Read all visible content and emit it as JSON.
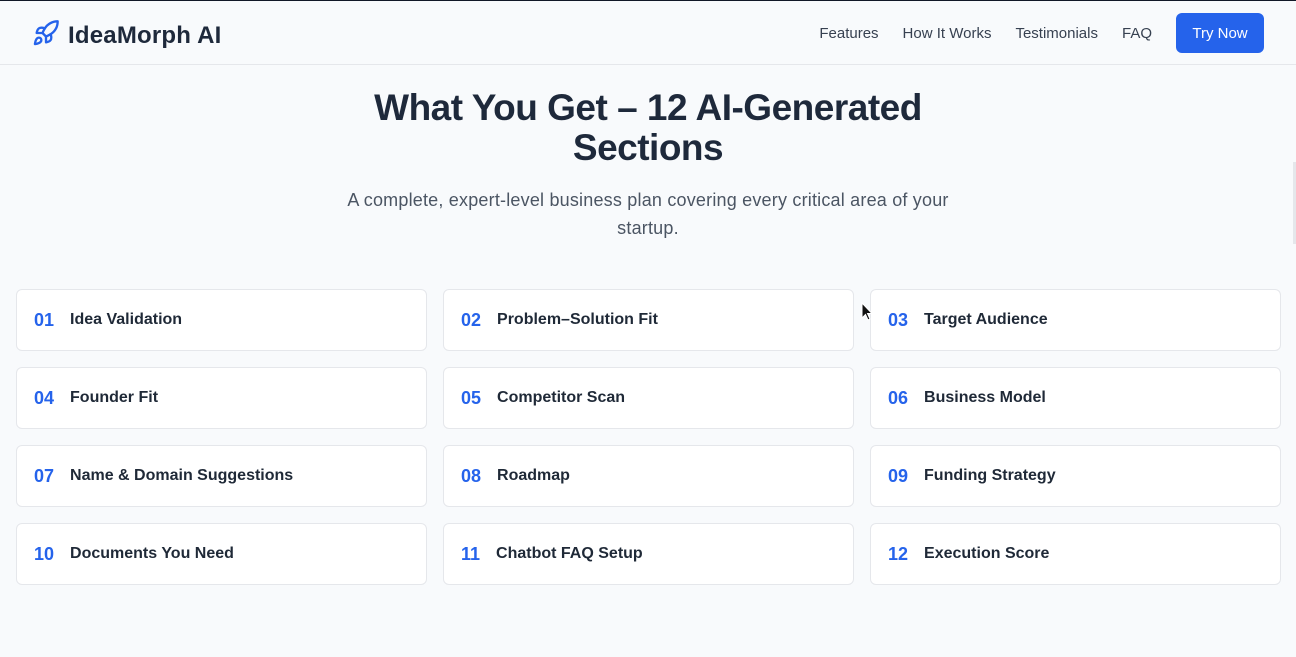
{
  "header": {
    "brand": "IdeaMorph AI",
    "nav": [
      "Features",
      "How It Works",
      "Testimonials",
      "FAQ"
    ],
    "cta": "Try Now"
  },
  "hero": {
    "title": "What You Get – 12 AI-Generated Sections",
    "subtitle": "A complete, expert-level business plan covering every critical area of your startup."
  },
  "sections": [
    {
      "num": "01",
      "label": "Idea Validation"
    },
    {
      "num": "02",
      "label": "Problem–Solution Fit"
    },
    {
      "num": "03",
      "label": "Target Audience"
    },
    {
      "num": "04",
      "label": "Founder Fit"
    },
    {
      "num": "05",
      "label": "Competitor Scan"
    },
    {
      "num": "06",
      "label": "Business Model"
    },
    {
      "num": "07",
      "label": "Name & Domain Suggestions"
    },
    {
      "num": "08",
      "label": "Roadmap"
    },
    {
      "num": "09",
      "label": "Funding Strategy"
    },
    {
      "num": "10",
      "label": "Documents You Need"
    },
    {
      "num": "11",
      "label": "Chatbot FAQ Setup"
    },
    {
      "num": "12",
      "label": "Execution Score"
    }
  ],
  "colors": {
    "accent": "#2563eb",
    "background": "#f8fafc",
    "card_border": "#e5e7eb",
    "text_dark": "#1e293b"
  },
  "icons": {
    "brand": "rocket-icon",
    "cursor": "mouse-pointer-icon"
  }
}
